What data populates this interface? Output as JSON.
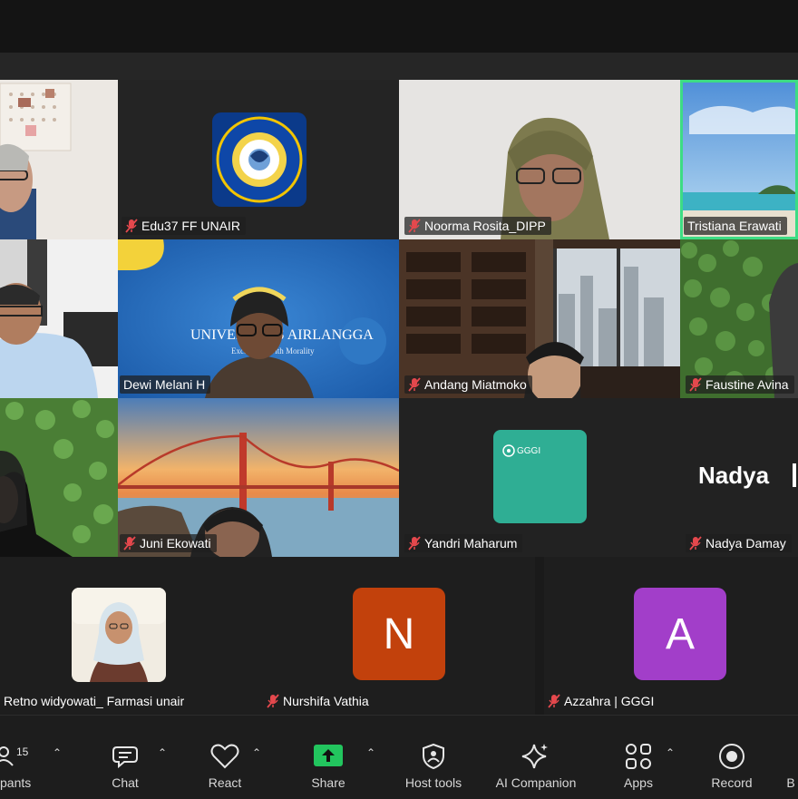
{
  "participants": {
    "edu37": "Edu37 FF UNAIR",
    "noorma": "Noorma Rosita_DIPP",
    "tristiana": "Tristiana Erawati",
    "dewi": "Dewi Melani H",
    "andang": "Andang Miatmoko",
    "faustine": "Faustine Avina",
    "juni": "Juni Ekowati",
    "yandri": "Yandri Maharum",
    "nadya_display": "Nadya",
    "nadya": "Nadya Damay",
    "retno": "Retno widyowati_ Farmasi unair",
    "nurshifa": "Nurshifa Vathia",
    "azzahra": "Azzahra | GGGI"
  },
  "avatars": {
    "nurshifa_initial": "N",
    "azzahra_initial": "A",
    "nurshifa_color": "#c2410c",
    "azzahra_color": "#a23ec9"
  },
  "logos": {
    "gggi": "GGGI",
    "unair_bg_text": "UNIVERSITAS AIRLANGGA",
    "unair_bg_sub": "Excellence with Morality"
  },
  "toolbar": {
    "participants_count": "15",
    "participants_label": "pants",
    "chat_label": "Chat",
    "react_label": "React",
    "share_label": "Share",
    "host_tools_label": "Host tools",
    "ai_label": "AI Companion",
    "apps_label": "Apps",
    "record_label": "Record",
    "more_label": "B"
  },
  "colors": {
    "active_speaker_border": "#3ddc84",
    "share_green": "#22c55e",
    "mute_red": "#e5484d",
    "gggi_teal": "#2fae94"
  }
}
